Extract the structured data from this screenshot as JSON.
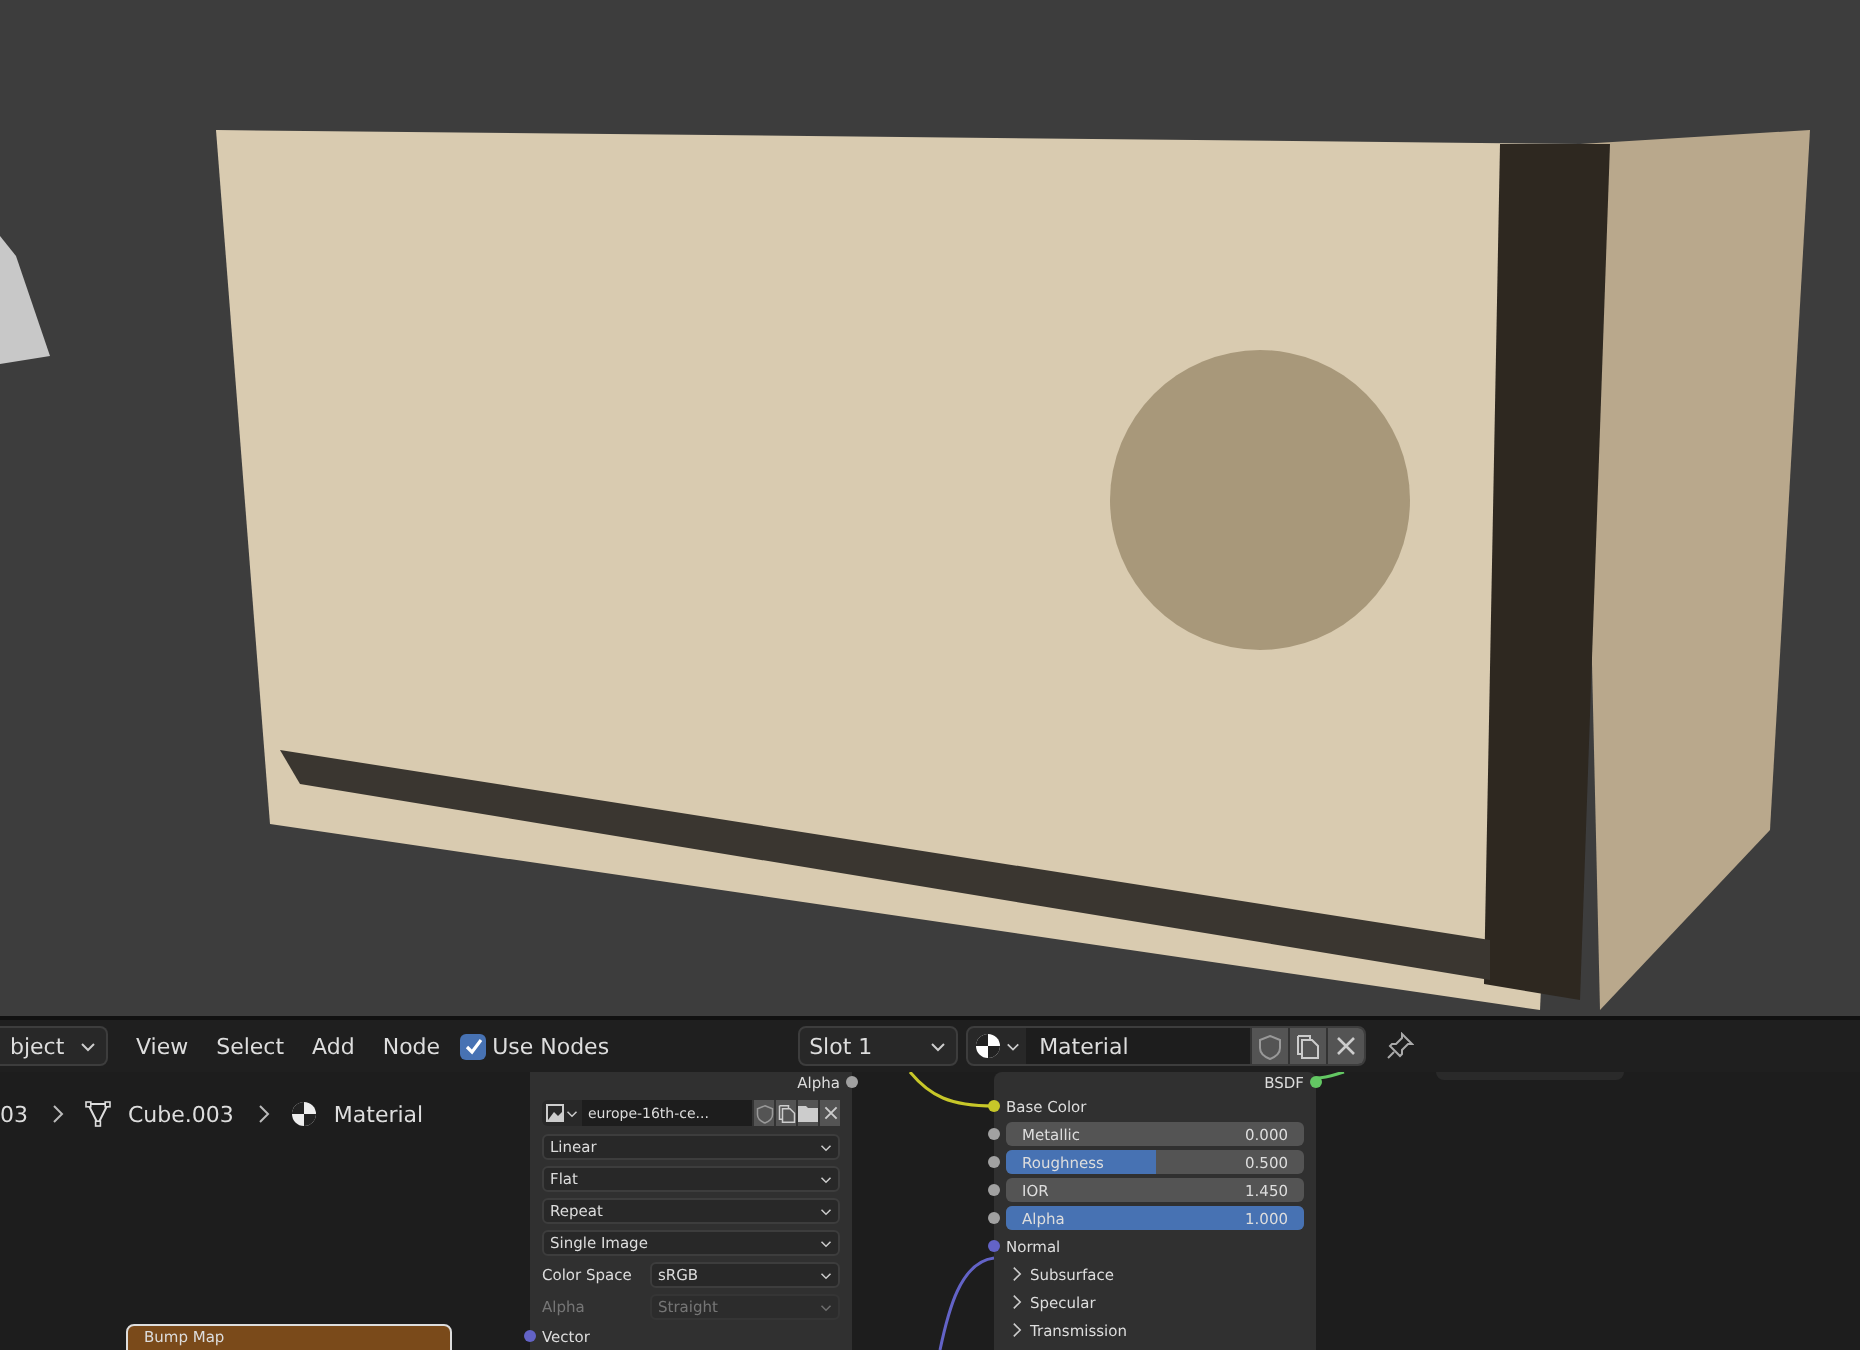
{
  "header": {
    "mode_menu": "bject",
    "menus": [
      "View",
      "Select",
      "Add",
      "Node"
    ],
    "use_nodes": {
      "label": "Use Nodes",
      "checked": true
    },
    "slot": "Slot 1",
    "material": "Material"
  },
  "breadcrumbs": [
    {
      "kind": "text",
      "label": "03"
    },
    {
      "kind": "mesh",
      "label": "Cube.003"
    },
    {
      "kind": "material",
      "label": "Material"
    }
  ],
  "image_node": {
    "output": "Alpha",
    "image": "europe-16th-ce...",
    "settings": [
      {
        "kind": "dropdown",
        "value": "Linear",
        "disabled": false
      },
      {
        "kind": "dropdown",
        "value": "Flat",
        "disabled": false
      },
      {
        "kind": "dropdown",
        "value": "Repeat",
        "disabled": false
      },
      {
        "kind": "dropdown",
        "value": "Single Image",
        "disabled": false
      },
      {
        "kind": "labeled",
        "label": "Color Space",
        "value": "sRGB",
        "disabled": false
      },
      {
        "kind": "labeled",
        "label": "Alpha",
        "value": "Straight",
        "disabled": true
      }
    ],
    "input": {
      "label": "Vector",
      "color": "#6363c7"
    }
  },
  "bsdf_node": {
    "output": {
      "label": "BSDF",
      "color": "#63c763"
    },
    "rows": [
      {
        "kind": "socket",
        "label": "Base Color",
        "color": "#c7c729"
      },
      {
        "kind": "slider",
        "label": "Metallic",
        "value": "0.000",
        "level": 0,
        "color": "#a1a1a1"
      },
      {
        "kind": "slider",
        "label": "Roughness",
        "value": "0.500",
        "level": 0.5,
        "color": "#a1a1a1"
      },
      {
        "kind": "number",
        "label": "IOR",
        "value": "1.450",
        "color": "#a1a1a1"
      },
      {
        "kind": "slider",
        "label": "Alpha",
        "value": "1.000",
        "level": 1,
        "color": "#a1a1a1"
      },
      {
        "kind": "socket",
        "label": "Normal",
        "color": "#6363c7"
      },
      {
        "kind": "panel",
        "label": "Subsurface",
        "expanded": false
      },
      {
        "kind": "panel",
        "label": "Specular",
        "expanded": false
      },
      {
        "kind": "panel",
        "label": "Transmission",
        "expanded": false
      }
    ]
  },
  "bump_node": {
    "title": "Bump Map"
  }
}
